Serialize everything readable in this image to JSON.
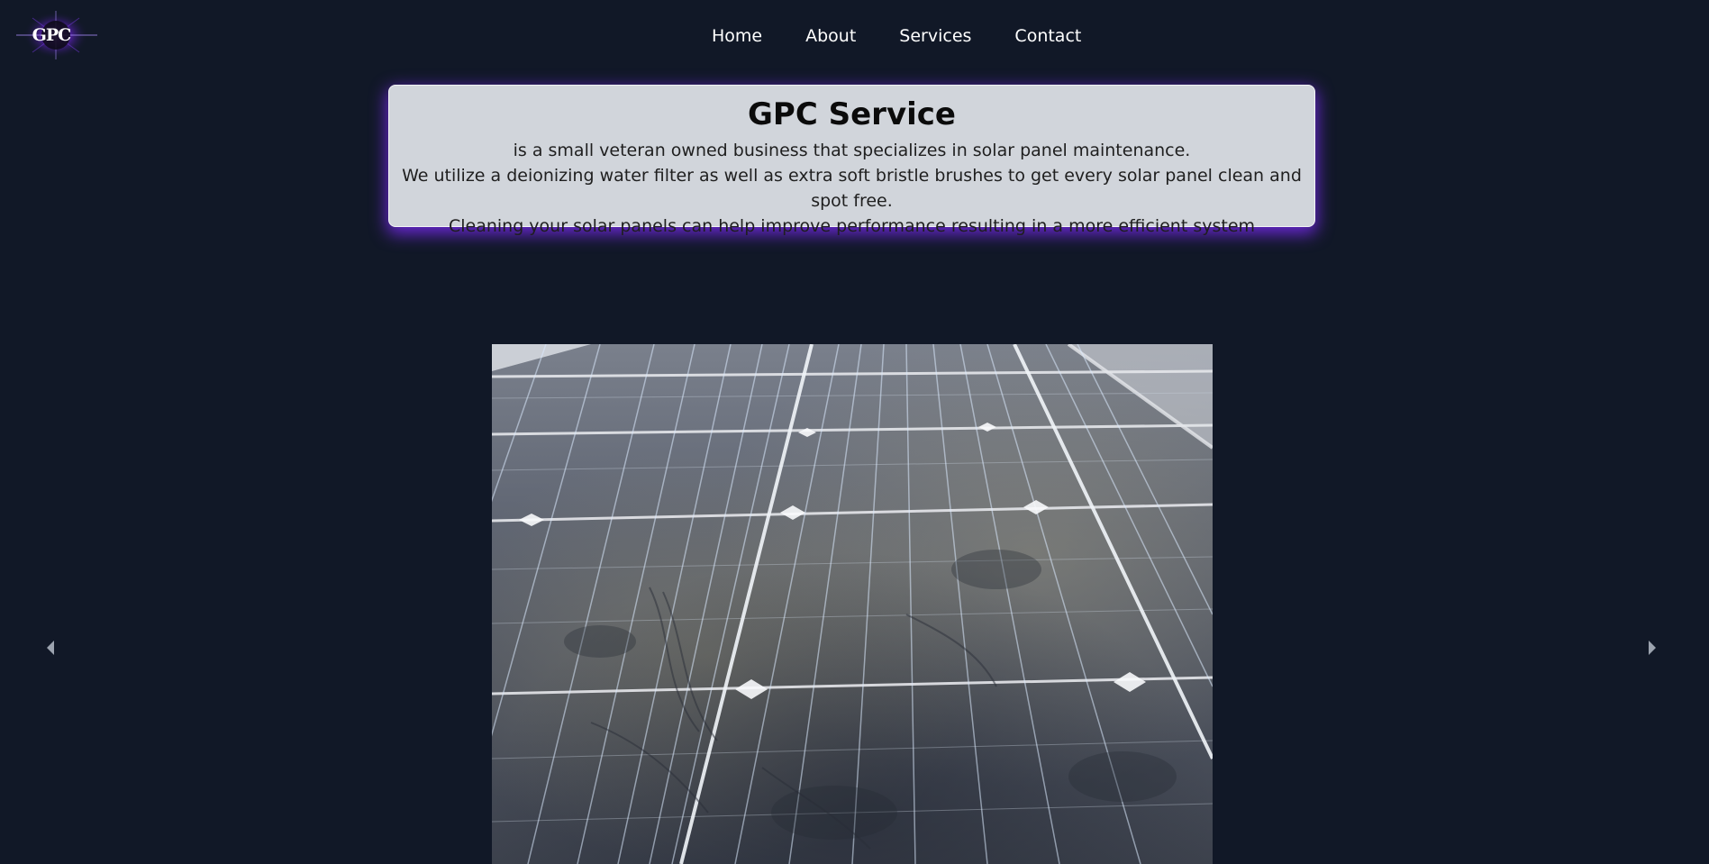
{
  "header": {
    "logo_text": "GPC",
    "nav": [
      {
        "label": "Home"
      },
      {
        "label": "About"
      },
      {
        "label": "Services"
      },
      {
        "label": "Contact"
      }
    ]
  },
  "hero": {
    "title": "GPC Service",
    "lines": [
      "is a small veteran owned business that specializes in solar panel maintenance.",
      "We utilize a deionizing water filter as well as extra soft bristle brushes to get every solar panel clean and spot free.",
      "Cleaning your solar panels can help improve performance resulting in a more efficient system"
    ]
  },
  "carousel": {
    "prev_icon": "caret-left-icon",
    "next_icon": "caret-right-icon",
    "slide_image": "dusty-solar-panel-photo"
  },
  "colors": {
    "background": "#111827",
    "card": "#d1d5db",
    "accent_glow": "#6d28d9",
    "arrow": "#9ca3af"
  }
}
